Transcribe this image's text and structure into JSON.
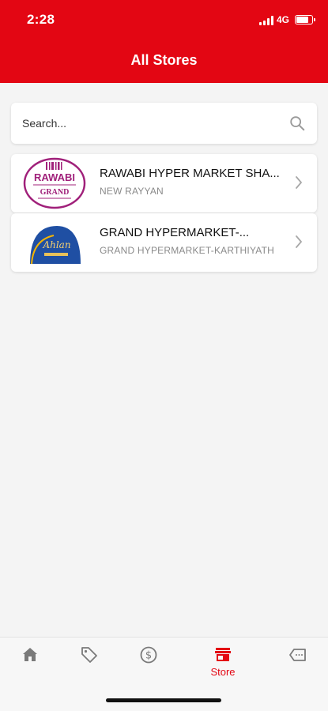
{
  "status_bar": {
    "time": "2:28",
    "network": "4G",
    "battery_level": 0.85
  },
  "header": {
    "title": "All Stores"
  },
  "search": {
    "placeholder": "Search..."
  },
  "stores": [
    {
      "name": "RAWABI HYPER MARKET SHA...",
      "subtitle": "NEW RAYYAN",
      "logo_text": "RAWABI",
      "logo_subtext": "GRAND"
    },
    {
      "name": "GRAND HYPERMARKET-...",
      "subtitle": "GRAND HYPERMARKET-KARTHIYATH",
      "logo_text": "Ahlan"
    }
  ],
  "tabbar": {
    "items": [
      {
        "icon": "home-icon",
        "label": ""
      },
      {
        "icon": "tag-icon",
        "label": ""
      },
      {
        "icon": "dollar-icon",
        "label": ""
      },
      {
        "icon": "store-icon",
        "label": "Store",
        "active": true
      },
      {
        "icon": "coupon-icon",
        "label": ""
      }
    ]
  },
  "colors": {
    "brand": "#e30613",
    "inactive_icon": "#7a7a7a",
    "background": "#f4f4f4"
  }
}
